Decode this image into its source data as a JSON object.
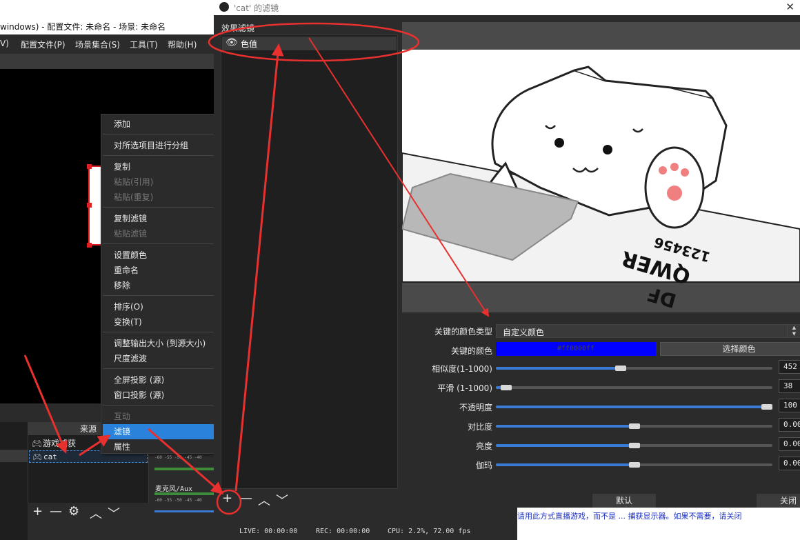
{
  "main_window": {
    "title": "windows) - 配置文件: 未命名 - 场景: 未命名",
    "menu": [
      "V)",
      "配置文件(P)",
      "场景集合(S)",
      "工具(T)",
      "帮助(H)"
    ],
    "sources_header": "来源",
    "sources": [
      {
        "name": "游戏捕获",
        "icon": "gamepad-icon"
      },
      {
        "name": "cat",
        "icon": "gamepad-icon"
      }
    ],
    "toolbar": {
      "add": "+",
      "remove": "—",
      "settings": "⚙",
      "up": "︿",
      "down": "﹀"
    },
    "mixer": {
      "scale": "-60  -55  -50  -45  -40",
      "track_label": "麦克风/Aux"
    }
  },
  "context_menu": {
    "items": [
      {
        "label": "添加",
        "submenu": true,
        "disabled": false
      },
      {
        "label": "对所选项目进行分组",
        "submenu": false,
        "disabled": false
      },
      {
        "label": "复制",
        "submenu": false,
        "disabled": false
      },
      {
        "label": "粘贴(引用)",
        "submenu": false,
        "disabled": true
      },
      {
        "label": "粘贴(重复)",
        "submenu": false,
        "disabled": true
      },
      {
        "label": "复制滤镜",
        "submenu": false,
        "disabled": false
      },
      {
        "label": "粘贴滤镜",
        "submenu": false,
        "disabled": true
      },
      {
        "label": "设置颜色",
        "submenu": true,
        "disabled": false
      },
      {
        "label": "重命名",
        "submenu": false,
        "disabled": false
      },
      {
        "label": "移除",
        "submenu": false,
        "disabled": false
      },
      {
        "label": "排序(O)",
        "submenu": true,
        "disabled": false
      },
      {
        "label": "变换(T)",
        "submenu": true,
        "disabled": false
      },
      {
        "label": "调整输出大小 (到源大小)",
        "submenu": false,
        "disabled": false
      },
      {
        "label": "尺度滤波",
        "submenu": true,
        "disabled": false
      },
      {
        "label": "全屏投影 (源)",
        "submenu": true,
        "disabled": false
      },
      {
        "label": "窗口投影 (源)",
        "submenu": false,
        "disabled": false
      },
      {
        "label": "互动",
        "submenu": false,
        "disabled": true
      },
      {
        "label": "滤镜",
        "submenu": false,
        "disabled": false,
        "selected": true
      },
      {
        "label": "属性",
        "submenu": false,
        "disabled": false
      }
    ]
  },
  "filters_dialog": {
    "title": "'cat' 的滤镜",
    "close": "✕",
    "effects_label": "效果滤镜",
    "filters": [
      {
        "name": "色值",
        "visible": true
      }
    ],
    "toolbar": {
      "add": "+",
      "remove": "—",
      "up": "︿",
      "down": "﹀"
    },
    "props": {
      "key_color_type_label": "关键的颜色类型",
      "key_color_type_value": "自定义颜色",
      "key_color_label": "关键的颜色",
      "key_color_hex": "#ff0000ff",
      "key_color_swatch": "#0000ff",
      "select_color_button": "选择颜色",
      "sliders": [
        {
          "label": "相似度(1-1000)",
          "value": "452",
          "fraction": 0.452
        },
        {
          "label": "平滑 (1-1000)",
          "value": "38",
          "fraction": 0.038
        },
        {
          "label": "不透明度",
          "value": "100",
          "fraction": 1.0
        },
        {
          "label": "对比度",
          "value": "0.00",
          "fraction": 0.5
        },
        {
          "label": "亮度",
          "value": "0.00",
          "fraction": 0.5
        },
        {
          "label": "伽玛",
          "value": "0.00",
          "fraction": 0.5
        }
      ]
    },
    "buttons": {
      "defaults": "默认",
      "close": "关闭"
    }
  },
  "status_bar": {
    "live": "LIVE: 00:00:00",
    "rec": "REC: 00:00:00",
    "cpu": "CPU: 2.2%, 72.00 fps"
  },
  "background_page": {
    "text": "请用此方式直播游戏，而不是 ... 捕获显示器。如果不需要，请关闭"
  },
  "annotation_color": "#e8312f"
}
